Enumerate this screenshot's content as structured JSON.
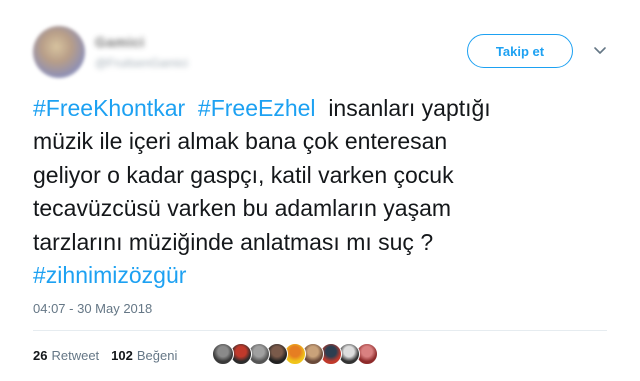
{
  "author": {
    "display_name": "Gamici",
    "handle": "@FruitsenGamici",
    "follow_label": "Takip et"
  },
  "tweet": {
    "lines": [
      [
        {
          "text": "#FreeKhontkar",
          "hashtag": true
        },
        {
          "text": "  ",
          "hashtag": false
        },
        {
          "text": "#FreeEzhel",
          "hashtag": true
        },
        {
          "text": "  insanları yaptığı",
          "hashtag": false
        }
      ],
      [
        {
          "text": "müzik ile içeri almak bana çok enteresan",
          "hashtag": false
        }
      ],
      [
        {
          "text": "geliyor o kadar gaspçı, katil varken çocuk",
          "hashtag": false
        }
      ],
      [
        {
          "text": "tecavüzcüsü varken bu adamların yaşam",
          "hashtag": false
        }
      ],
      [
        {
          "text": "tarzlarını müziğinde anlatması mı suç ?",
          "hashtag": false
        }
      ],
      [
        {
          "text": "#zihnimizözgür",
          "hashtag": true
        }
      ]
    ],
    "timestamp": "04:07 - 30 May 2018"
  },
  "stats": {
    "retweets": {
      "count": "26",
      "label": "Retweet"
    },
    "likes": {
      "count": "102",
      "label": "Beğeni"
    }
  },
  "likers": [
    {
      "colors": [
        "#3a3a3a",
        "#8a8a8a"
      ]
    },
    {
      "colors": [
        "#2c2c2c",
        "#c0392b"
      ]
    },
    {
      "colors": [
        "#555555",
        "#a0a0a0"
      ]
    },
    {
      "colors": [
        "#222222",
        "#7a5a4a"
      ]
    },
    {
      "colors": [
        "#f0c419",
        "#e67e22"
      ]
    },
    {
      "colors": [
        "#6a4a3a",
        "#c9a27a"
      ]
    },
    {
      "colors": [
        "#c0392b",
        "#2c3e50"
      ]
    },
    {
      "colors": [
        "#333333",
        "#dddddd"
      ]
    },
    {
      "colors": [
        "#8e2b2b",
        "#d98080"
      ]
    }
  ],
  "colors": {
    "accent": "#1da1f2",
    "text": "#14171a",
    "muted": "#657786",
    "divider": "#e6ecf0"
  }
}
